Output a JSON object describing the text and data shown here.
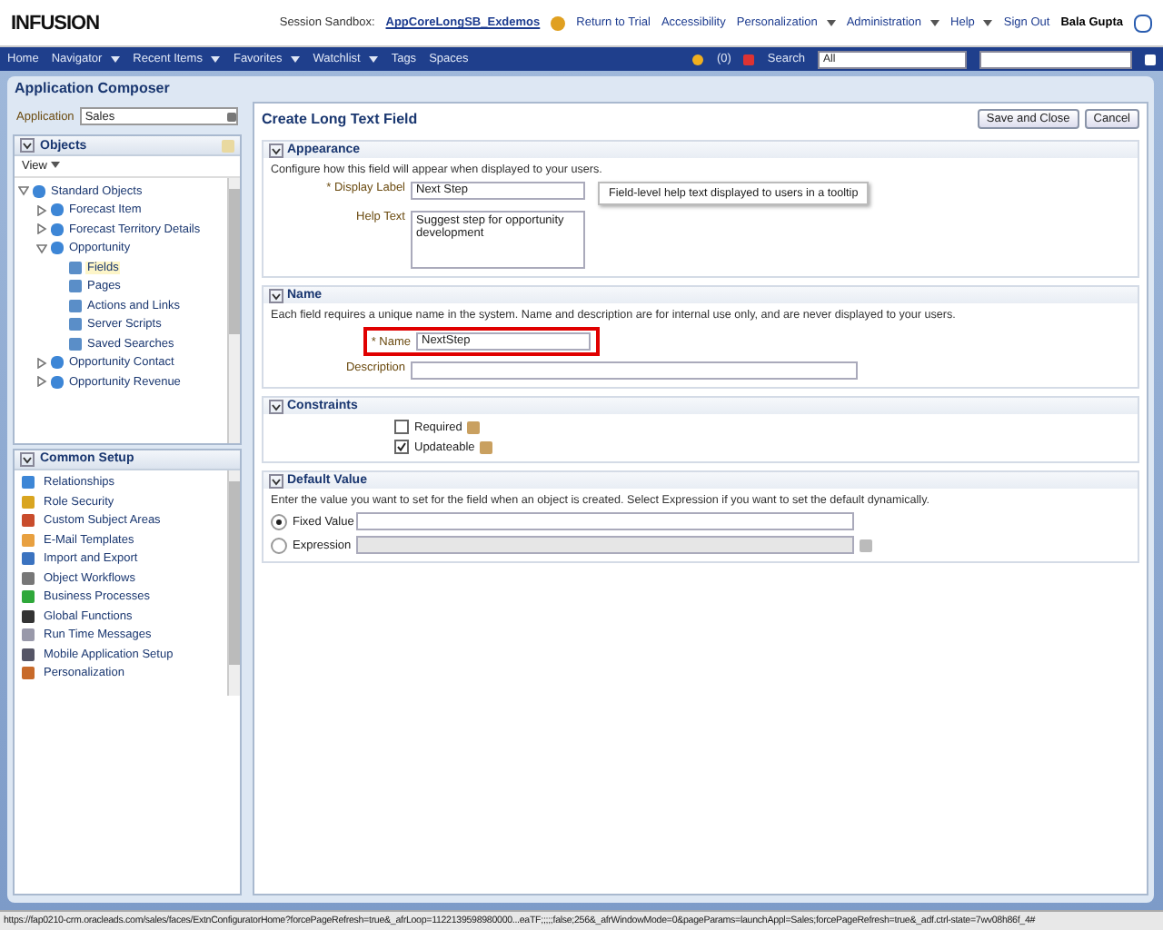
{
  "header": {
    "logo": "INFUSION",
    "session_label": "Session Sandbox:",
    "session_link": "AppCoreLongSB_Exdemos",
    "links": [
      {
        "label": "Return to Trial",
        "has_menu": false
      },
      {
        "label": "Accessibility",
        "has_menu": false
      },
      {
        "label": "Personalization",
        "has_menu": true
      },
      {
        "label": "Administration",
        "has_menu": true
      },
      {
        "label": "Help",
        "has_menu": true
      },
      {
        "label": "Sign Out",
        "has_menu": false
      }
    ],
    "user": "Bala Gupta"
  },
  "nav": {
    "items": [
      {
        "label": "Home",
        "has_menu": false
      },
      {
        "label": "Navigator",
        "has_menu": true
      },
      {
        "label": "Recent Items",
        "has_menu": true
      },
      {
        "label": "Favorites",
        "has_menu": true
      },
      {
        "label": "Watchlist",
        "has_menu": true
      },
      {
        "label": "Tags",
        "has_menu": false
      },
      {
        "label": "Spaces",
        "has_menu": false
      }
    ],
    "notifications": "(0)",
    "search_label": "Search",
    "search_scope": "All"
  },
  "panel_title": "Application Composer",
  "sidebar": {
    "application_label": "Application",
    "application_value": "Sales",
    "objects_title": "Objects",
    "objects_expanded": true,
    "view_menu": "View",
    "tree": [
      {
        "label": "Standard Objects",
        "expanded": true,
        "selected": false,
        "children": [
          {
            "label": "Forecast Item",
            "expanded": false,
            "selected": false
          },
          {
            "label": "Forecast Territory Details",
            "expanded": false,
            "selected": false
          },
          {
            "label": "Opportunity",
            "expanded": true,
            "selected": false,
            "children": [
              {
                "label": "Fields",
                "selected": true
              },
              {
                "label": "Pages",
                "selected": false
              },
              {
                "label": "Actions and Links",
                "selected": false
              },
              {
                "label": "Server Scripts",
                "selected": false
              },
              {
                "label": "Saved Searches",
                "selected": false
              }
            ]
          },
          {
            "label": "Opportunity Contact",
            "expanded": false,
            "selected": false
          },
          {
            "label": "Opportunity Revenue",
            "expanded": false,
            "selected": false
          }
        ]
      }
    ],
    "common_title": "Common Setup",
    "common_expanded": true,
    "common_items": [
      "Relationships",
      "Role Security",
      "Custom Subject Areas",
      "E-Mail Templates",
      "Import and Export",
      "Object Workflows",
      "Business Processes",
      "Global Functions",
      "Run Time Messages",
      "Mobile Application Setup",
      "Personalization"
    ]
  },
  "main": {
    "title": "Create Long Text Field",
    "buttons": [
      "Save and Close",
      "Cancel"
    ],
    "appearance": {
      "title": "Appearance",
      "expanded": true,
      "description": "Configure how this field will appear when displayed to your users.",
      "display_label": "* Display Label",
      "display_value": "Next Step",
      "tooltip": "Field-level help text displayed to users in a tooltip",
      "help_label": "Help Text",
      "help_value": "Suggest step for opportunity development"
    },
    "name": {
      "title": "Name",
      "expanded": true,
      "description": "Each field requires a unique name in the system. Name and description are for internal use only, and are never displayed to your users.",
      "name_label": "* Name",
      "name_value": "NextStep",
      "highlighted": true,
      "description_label": "Description"
    },
    "constraints": {
      "title": "Constraints",
      "expanded": true,
      "items": [
        {
          "label": "Required",
          "checked": false
        },
        {
          "label": "Updateable",
          "checked": true
        }
      ]
    },
    "default_value": {
      "title": "Default Value",
      "expanded": true,
      "description": "Enter the value you want to set for the field when an object is created. Select Expression if you want to set the default dynamically.",
      "options": [
        {
          "label": "Fixed Value",
          "selected": true,
          "kind": "text"
        },
        {
          "label": "Expression",
          "selected": false,
          "kind": "expression"
        }
      ]
    }
  },
  "status_bar": "https://fap0210-crm.oracleads.com/sales/faces/ExtnConfiguratorHome?forcePageRefresh=true&_afrLoop=1122139598980000...eaTF;;;;;false;256&_afrWindowMode=0&pageParams=launchAppl=Sales;forcePageRefresh=true&_adf.ctrl-state=7wv08h86f_4#"
}
